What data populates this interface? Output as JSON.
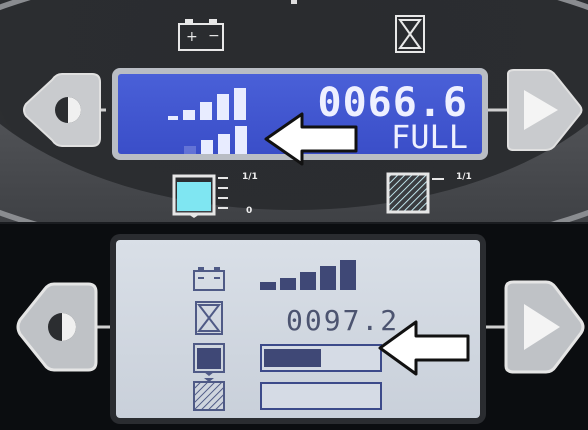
{
  "panel_top": {
    "display": {
      "hour_meter": "0066.6",
      "status": "FULL",
      "battery_level_bars": 5
    },
    "indicators": {
      "water_full_label": "1/1",
      "water_empty_label": "0",
      "recovery_full_label": "1/1"
    },
    "icons": [
      "battery-icon",
      "hourglass-icon",
      "contrast-icon",
      "right-arrow-icon",
      "clean-water-tank-icon",
      "recovery-tank-icon",
      "pointer-arrow-icon"
    ]
  },
  "panel_bottom": {
    "display": {
      "hour_meter": "0097.2",
      "battery_level_bars": 5,
      "solution_gauge_level": 0.5,
      "recovery_gauge_level": 0.0
    },
    "icons": [
      "battery-icon",
      "hourglass-icon",
      "clean-water-tank-icon",
      "recovery-tank-icon",
      "contrast-icon",
      "right-arrow-icon",
      "pointer-arrow-icon"
    ]
  },
  "colors": {
    "lcd_blue": "#3a4ec8",
    "lcd_grey": "#cfd5de",
    "segment_dark": "#3f4876",
    "cyan_tank": "#7fe6f2"
  }
}
